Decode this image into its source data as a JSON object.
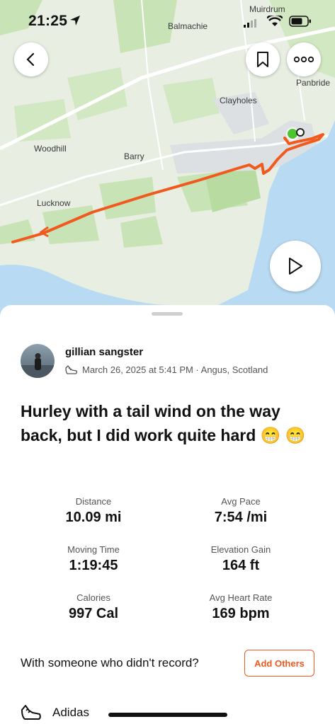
{
  "status_bar": {
    "time": "21:25"
  },
  "map": {
    "place_labels": [
      "Muirdrum",
      "Balmachie",
      "Panbride",
      "Clayholes",
      "Woodhill",
      "Barry",
      "Lucknow"
    ],
    "colors": {
      "route": "#f05a1e",
      "water": "#b8daf2",
      "land": "#e8eee2",
      "green": "#c8e3b6",
      "start": "#4cc531"
    }
  },
  "top_buttons": {
    "back": "chevron-left-icon",
    "save": "bookmark-icon",
    "more": "more-icon",
    "play": "play-icon"
  },
  "activity": {
    "author": "gillian sangster",
    "meta": "March 26, 2025 at 5:41 PM · Angus, Scotland",
    "title": "Hurley with a tail wind on the way back, but I did work quite hard 😁 😁"
  },
  "stats": [
    {
      "label": "Distance",
      "value": "10.09 mi"
    },
    {
      "label": "Avg Pace",
      "value": "7:54 /mi"
    },
    {
      "label": "Moving Time",
      "value": "1:19:45"
    },
    {
      "label": "Elevation Gain",
      "value": "164 ft"
    },
    {
      "label": "Calories",
      "value": "997 Cal"
    },
    {
      "label": "Avg Heart Rate",
      "value": "169 bpm"
    }
  ],
  "with_others": {
    "prompt": "With someone who didn't record?",
    "button": "Add Others"
  },
  "gear": {
    "name": "Adidas"
  }
}
